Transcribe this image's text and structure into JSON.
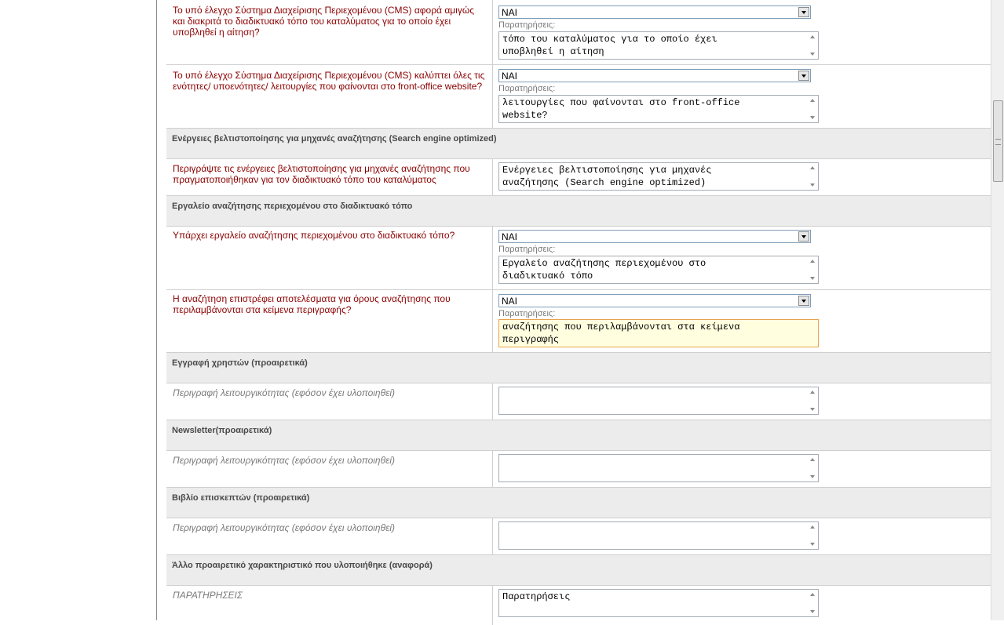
{
  "label_remarks": "Παρατηρήσεις:",
  "rows": [
    {
      "question": "Το υπό έλεγχο Σύστημα Διαχείρισης Περιεχομένου (CMS) αφορά αμιγώς και διακριτά το διαδικτυακό τόπο του καταλύματος για το οποίο έχει υποβληθεί η αίτηση?",
      "select": "ΝΑΙ",
      "remarks": "τόπο του καταλύματος για το οποίο έχει\nυποβληθεί η αίτηση"
    },
    {
      "question": "Το υπό έλεγχο Σύστημα Διαχείρισης Περιεχομένου (CMS) καλύπτει όλες τις ενότητες/ υποενότητες/ λειτουργίες που φαίνονται στο front-office website?",
      "select": "ΝΑΙ",
      "remarks": "λειτουργίες που φαίνονται στο front-office\nwebsite?"
    }
  ],
  "sections": {
    "seo": {
      "title": "Ενέργειες βελτιστοποίησης για μηχανές αναζήτησης (Search engine optimized)",
      "question": "Περιγράψτε τις ενέργειες βελτιστοποίησης για μηχανές αναζήτησης που πραγματοποιήθηκαν για τον διαδικτυακό τόπο του καταλύματος",
      "remarks": "Ενέργειες βελτιστοποίησης για μηχανές\nαναζήτησης (Search engine optimized)"
    },
    "search_tool": {
      "title": "Εργαλείο αναζήτησης περιεχομένου στο διαδικτυακό τόπο",
      "q1": "Υπάρχει εργαλείο αναζήτησης περιεχομένου στο διαδικτυακό τόπο?",
      "q1_select": "ΝΑΙ",
      "q1_remarks": "Εργαλείο αναζήτησης περιεχομένου στο\nδιαδικτυακό τόπο",
      "q2": "Η αναζήτηση επιστρέφει αποτελέσματα για όρους αναζήτησης που περιλαμβάνονται στα κείμενα περιγραφής?",
      "q2_select": "ΝΑΙ",
      "q2_remarks": "αναζήτησης που περιλαμβάνονται στα κείμενα\nπεριγραφής"
    },
    "registration": {
      "title": "Εγγραφή χρηστών (προαιρετικά)",
      "desc": "Περιγραφή λειτουργικότητας (εφόσον έχει υλοποιηθεί)",
      "remarks": ""
    },
    "newsletter": {
      "title": "Newsletter(προαιρετικά)",
      "desc": "Περιγραφή λειτουργικότητας (εφόσον έχει υλοποιηθεί)",
      "remarks": ""
    },
    "guestbook": {
      "title": "Βιβλίο επισκεπτών (προαιρετικά)",
      "desc": "Περιγραφή λειτουργικότητας (εφόσον έχει υλοποιηθεί)",
      "remarks": ""
    },
    "other": {
      "title": "Άλλο προαιρετικό χαρακτηριστικό που υλοποιήθηκε (αναφορά)",
      "desc": "ΠΑΡΑΤΗΡΗΣΕΙΣ",
      "remarks": "Παρατηρήσεις"
    }
  }
}
